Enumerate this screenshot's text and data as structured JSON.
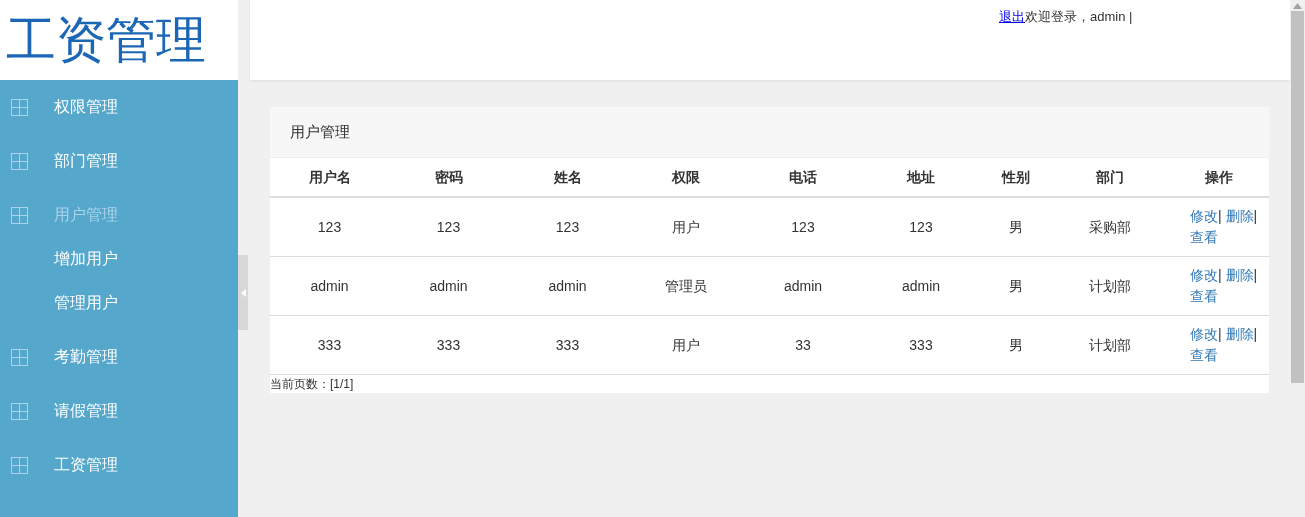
{
  "logo": "工资管理",
  "sidebar": {
    "items": [
      {
        "label": "权限管理",
        "selected": false
      },
      {
        "label": "部门管理",
        "selected": false
      },
      {
        "label": "用户管理",
        "selected": true,
        "children": [
          {
            "label": "增加用户"
          },
          {
            "label": "管理用户"
          }
        ]
      },
      {
        "label": "考勤管理",
        "selected": false
      },
      {
        "label": "请假管理",
        "selected": false
      },
      {
        "label": "工资管理",
        "selected": false
      }
    ]
  },
  "header": {
    "logout": "退出",
    "welcome": "欢迎登录，admin |"
  },
  "panel": {
    "title": "用户管理",
    "table": {
      "columns": [
        "用户名",
        "密码",
        "姓名",
        "权限",
        "电话",
        "地址",
        "性别",
        "部门",
        "操作"
      ],
      "rows": [
        {
          "cells": [
            "123",
            "123",
            "123",
            "用户",
            "123",
            "123",
            "男",
            "采购部"
          ],
          "actions": [
            {
              "label": "修改",
              "sep": "|"
            },
            {
              "label": "删除",
              "sep": "|"
            },
            {
              "label": "查看"
            }
          ]
        },
        {
          "cells": [
            "admin",
            "admin",
            "admin",
            "管理员",
            "admin",
            "admin",
            "男",
            "计划部"
          ],
          "actions": [
            {
              "label": "修改",
              "sep": "|"
            },
            {
              "label": "删除",
              "sep": "|"
            },
            {
              "label": "查看"
            }
          ]
        },
        {
          "cells": [
            "333",
            "333",
            "333",
            "用户",
            "33",
            "333",
            "男",
            "计划部"
          ],
          "actions": [
            {
              "label": "修改",
              "sep": "|"
            },
            {
              "label": "删除",
              "sep": "|"
            },
            {
              "label": "查看"
            }
          ]
        }
      ]
    },
    "pagination": "当前页数：[1/1]"
  }
}
